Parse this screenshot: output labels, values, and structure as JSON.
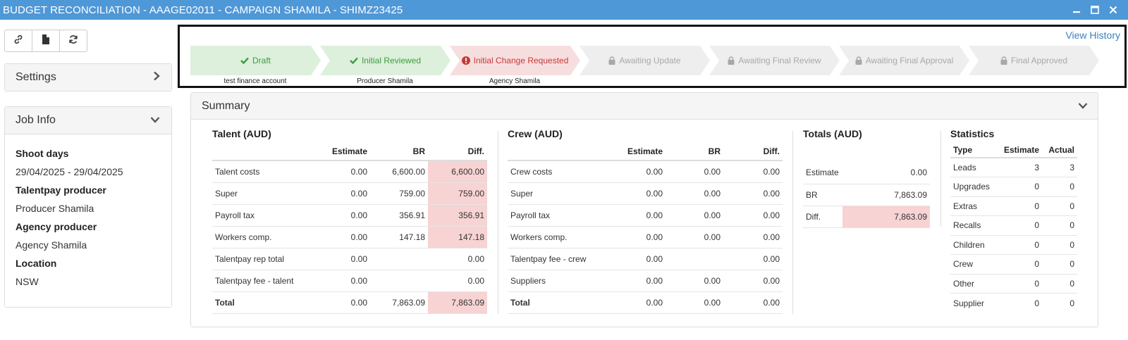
{
  "window": {
    "title": "BUDGET RECONCILIATION - AAAGE02011 - CAMPAIGN SHAMILA - SHIMZ23425",
    "buttons": [
      "minimize-icon",
      "maximize-icon",
      "close-icon"
    ]
  },
  "toolbar": {
    "icons": [
      "link-icon",
      "document-icon",
      "refresh-icon"
    ]
  },
  "settings": {
    "label": "Settings"
  },
  "job_info": {
    "label": "Job Info",
    "fields": [
      {
        "label": "Shoot days",
        "value": "29/04/2025 - 29/04/2025"
      },
      {
        "label": "Talentpay producer",
        "value": "Producer Shamila"
      },
      {
        "label": "Agency producer",
        "value": "Agency Shamila"
      },
      {
        "label": "Location",
        "value": "NSW"
      }
    ]
  },
  "workflow": {
    "view_history": "View History",
    "steps": [
      {
        "label": "Draft",
        "status": "done",
        "sub": "test finance account"
      },
      {
        "label": "Initial Reviewed",
        "status": "done",
        "sub": "Producer Shamila"
      },
      {
        "label": "Initial Change Requested",
        "status": "current",
        "sub": "Agency Shamila"
      },
      {
        "label": "Awaiting Update",
        "status": "locked",
        "sub": ""
      },
      {
        "label": "Awaiting Final Review",
        "status": "locked",
        "sub": ""
      },
      {
        "label": "Awaiting Final Approval",
        "status": "locked",
        "sub": ""
      },
      {
        "label": "Final Approved",
        "status": "locked",
        "sub": ""
      }
    ],
    "colors": {
      "done": "#3f9c3f",
      "current": "#c43a3a",
      "locked": "#a8a8a8"
    }
  },
  "summary": {
    "label": "Summary",
    "talent": {
      "title": "Talent (AUD)",
      "headers": [
        "",
        "Estimate",
        "BR",
        "Diff."
      ],
      "rows": [
        {
          "label": "Talent costs",
          "estimate": "0.00",
          "br": "6,600.00",
          "diff": "6,600.00",
          "hl": true
        },
        {
          "label": "Super",
          "estimate": "0.00",
          "br": "759.00",
          "diff": "759.00",
          "hl": true
        },
        {
          "label": "Payroll tax",
          "estimate": "0.00",
          "br": "356.91",
          "diff": "356.91",
          "hl": true
        },
        {
          "label": "Workers comp.",
          "estimate": "0.00",
          "br": "147.18",
          "diff": "147.18",
          "hl": true
        },
        {
          "label": "Talentpay rep total",
          "estimate": "0.00",
          "br": "",
          "diff": "0.00",
          "hl": false
        },
        {
          "label": "Talentpay fee - talent",
          "estimate": "0.00",
          "br": "",
          "diff": "0.00",
          "hl": false
        },
        {
          "label": "Total",
          "estimate": "0.00",
          "br": "7,863.09",
          "diff": "7,863.09",
          "hl": true,
          "total": true
        }
      ]
    },
    "crew": {
      "title": "Crew (AUD)",
      "headers": [
        "",
        "Estimate",
        "BR",
        "Diff."
      ],
      "rows": [
        {
          "label": "Crew costs",
          "estimate": "0.00",
          "br": "0.00",
          "diff": "0.00"
        },
        {
          "label": "Super",
          "estimate": "0.00",
          "br": "0.00",
          "diff": "0.00"
        },
        {
          "label": "Payroll tax",
          "estimate": "0.00",
          "br": "0.00",
          "diff": "0.00"
        },
        {
          "label": "Workers comp.",
          "estimate": "0.00",
          "br": "0.00",
          "diff": "0.00"
        },
        {
          "label": "Talentpay fee - crew",
          "estimate": "0.00",
          "br": "",
          "diff": "0.00"
        },
        {
          "label": "Suppliers",
          "estimate": "0.00",
          "br": "0.00",
          "diff": "0.00"
        },
        {
          "label": "Total",
          "estimate": "0.00",
          "br": "0.00",
          "diff": "0.00",
          "total": true
        }
      ]
    },
    "totals": {
      "title": "Totals (AUD)",
      "rows": [
        {
          "label": "Estimate",
          "value": "0.00",
          "hl": false
        },
        {
          "label": "BR",
          "value": "7,863.09",
          "hl": false
        },
        {
          "label": "Diff.",
          "value": "7,863.09",
          "hl": true
        }
      ]
    },
    "statistics": {
      "title": "Statistics",
      "headers": [
        "Type",
        "Estimate",
        "Actual"
      ],
      "rows": [
        {
          "type": "Leads",
          "estimate": "3",
          "actual": "3"
        },
        {
          "type": "Upgrades",
          "estimate": "0",
          "actual": "0"
        },
        {
          "type": "Extras",
          "estimate": "0",
          "actual": "0"
        },
        {
          "type": "Recalls",
          "estimate": "0",
          "actual": "0"
        },
        {
          "type": "Children",
          "estimate": "0",
          "actual": "0"
        },
        {
          "type": "Crew",
          "estimate": "0",
          "actual": "0"
        },
        {
          "type": "Other",
          "estimate": "0",
          "actual": "0"
        },
        {
          "type": "Supplier",
          "estimate": "0",
          "actual": "0"
        }
      ]
    },
    "highlight_color": "#f7d3d3"
  }
}
